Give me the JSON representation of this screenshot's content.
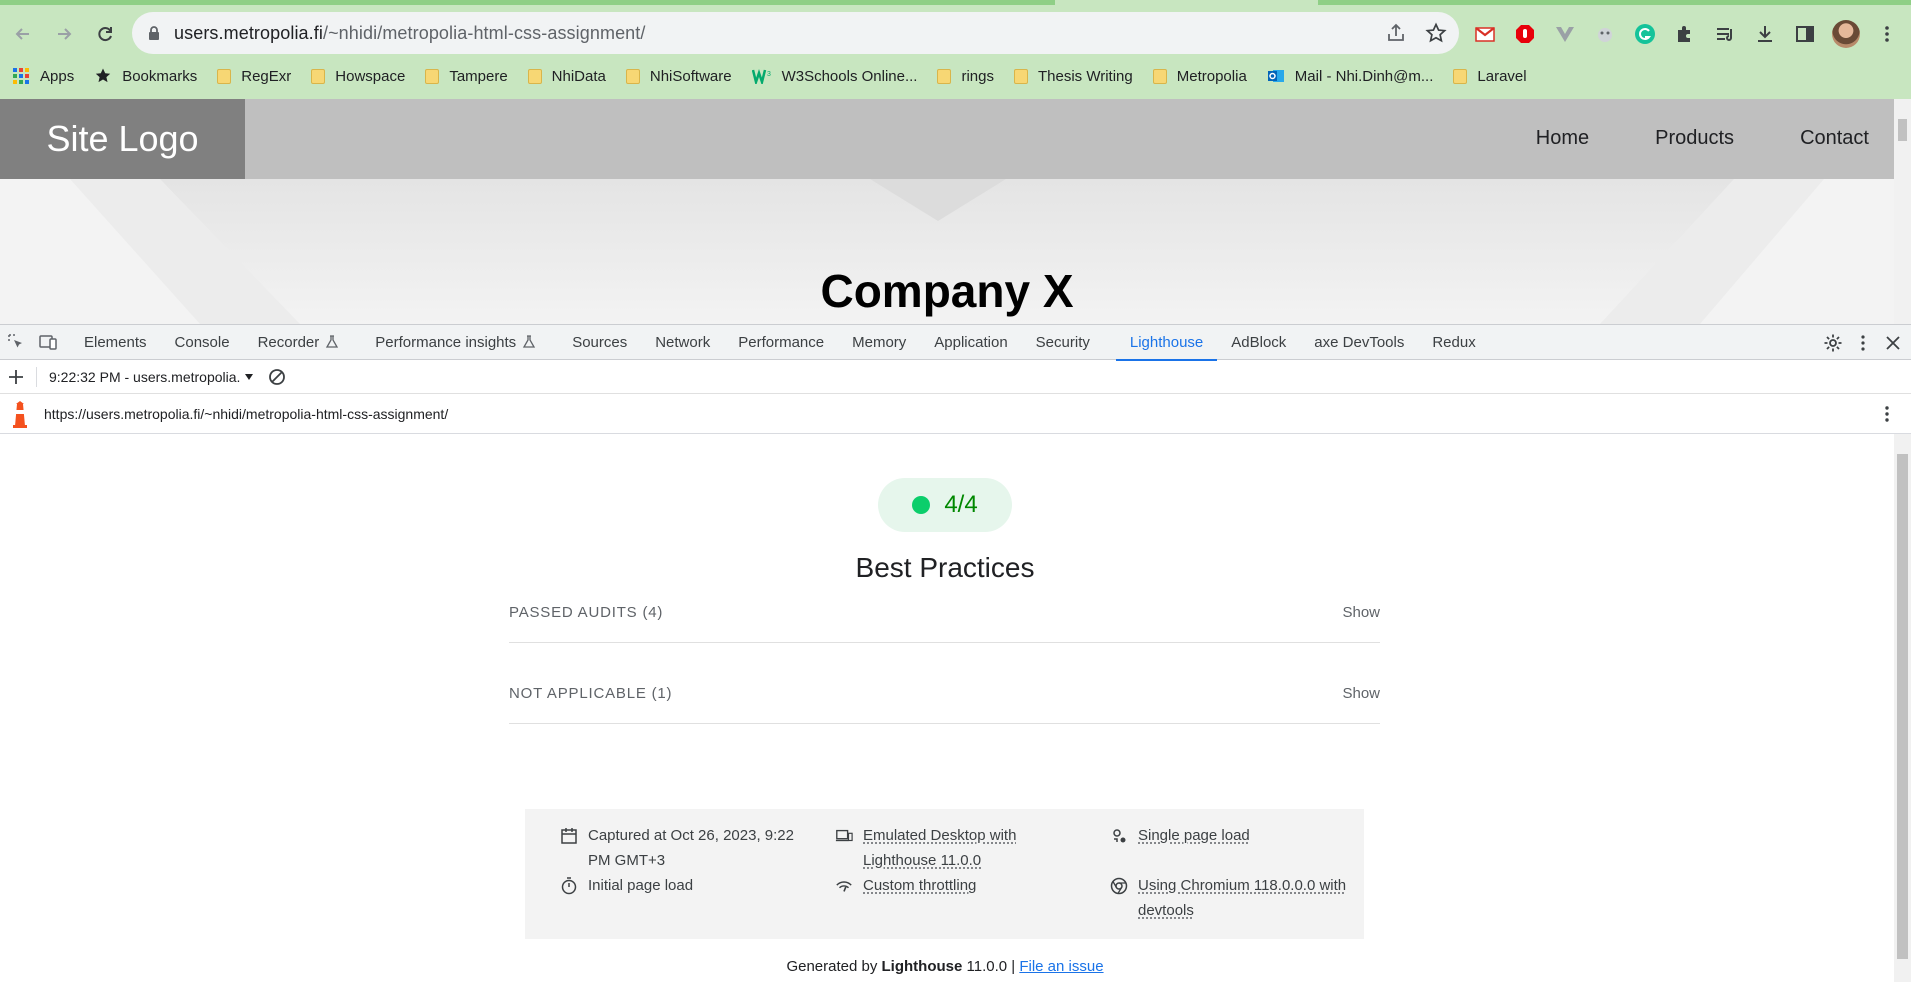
{
  "browser": {
    "url_host": "users.metropolia.fi",
    "url_path": "/~nhidi/metropolia-html-css-assignment/",
    "bookmarks": [
      {
        "label": "Apps",
        "icon": "apps-grid-icon"
      },
      {
        "label": "Bookmarks",
        "icon": "star-icon"
      },
      {
        "label": "RegExr",
        "icon": "folder-icon"
      },
      {
        "label": "Howspace",
        "icon": "folder-icon"
      },
      {
        "label": "Tampere",
        "icon": "folder-icon"
      },
      {
        "label": "NhiData",
        "icon": "folder-icon"
      },
      {
        "label": "NhiSoftware",
        "icon": "folder-icon"
      },
      {
        "label": "W3Schools Online...",
        "icon": "w3schools-icon"
      },
      {
        "label": "rings",
        "icon": "folder-icon"
      },
      {
        "label": "Thesis Writing",
        "icon": "folder-icon"
      },
      {
        "label": "Metropolia",
        "icon": "folder-icon"
      },
      {
        "label": "Mail - Nhi.Dinh@m...",
        "icon": "outlook-icon"
      },
      {
        "label": "Laravel",
        "icon": "folder-icon"
      }
    ]
  },
  "site": {
    "logo": "Site Logo",
    "nav": [
      "Home",
      "Products",
      "Contact"
    ],
    "hero_title": "Company X"
  },
  "devtools": {
    "tabs": [
      "Elements",
      "Console",
      "Recorder",
      "Performance insights",
      "Sources",
      "Network",
      "Performance",
      "Memory",
      "Application",
      "Security",
      "Lighthouse",
      "AdBlock",
      "axe DevTools",
      "Redux"
    ],
    "active_tab": "Lighthouse",
    "report_select": "9:22:32 PM - users.metropolia.",
    "report_url": "https://users.metropolia.fi/~nhidi/metropolia-html-css-assignment/"
  },
  "lighthouse": {
    "score": "4/4",
    "score_color": "#0cce6b",
    "category": "Best Practices",
    "groups": [
      {
        "title": "PASSED AUDITS",
        "count": "(4)",
        "action": "Show"
      },
      {
        "title": "NOT APPLICABLE",
        "count": "(1)",
        "action": "Show"
      }
    ],
    "env": {
      "captured_1": "Captured at Oct 26, 2023, 9:22",
      "captured_2": "PM GMT+3",
      "initial": "Initial page load",
      "emulated_1": "Emulated Desktop with",
      "emulated_2": "Lighthouse 11.0.0",
      "throttling": "Custom throttling",
      "single": "Single page load",
      "chromium_1": "Using Chromium 118.0.0.0 with",
      "chromium_2": "devtools"
    },
    "footer": {
      "prefix": "Generated by",
      "brand": "Lighthouse",
      "version": "11.0.0 |",
      "link": "File an issue"
    }
  }
}
